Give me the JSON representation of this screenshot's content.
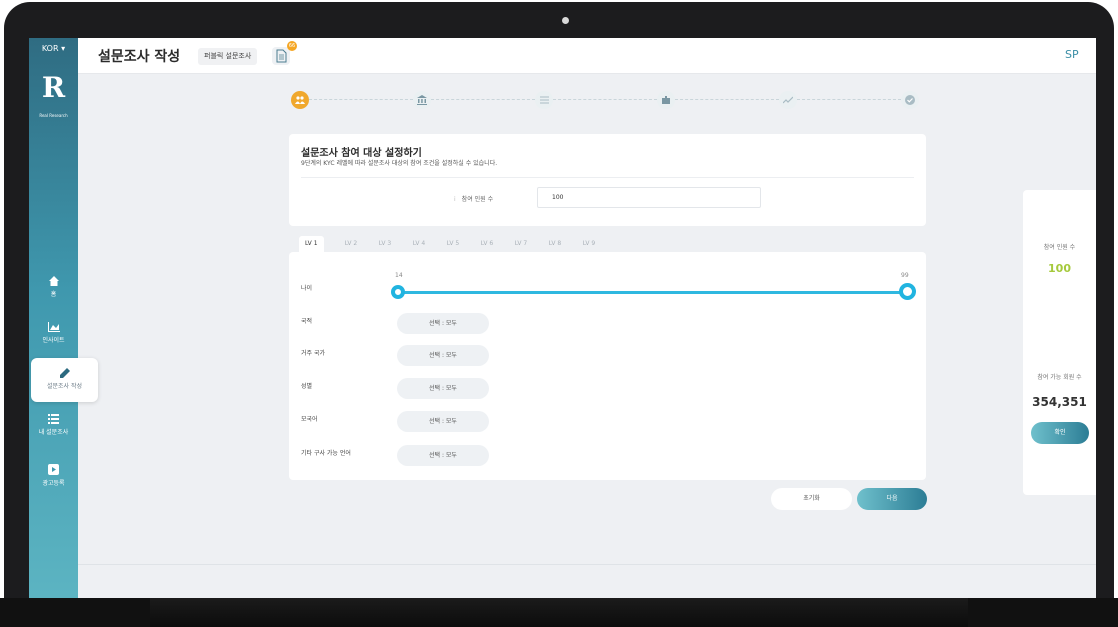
{
  "app": {
    "language": "KOR ▾",
    "logo_letter": "R",
    "logo_sub": "Real Research",
    "user_initials": "SP"
  },
  "header": {
    "title": "설문조사 작성",
    "tag": "퍼블릭 설문조사",
    "badge": "66"
  },
  "sidebar": {
    "items": [
      {
        "label": "홈",
        "icon": "home-icon"
      },
      {
        "label": "인사이트",
        "icon": "chart-icon"
      },
      {
        "label": "설문조사 작성",
        "icon": "pencil-icon"
      },
      {
        "label": "내 설문조사",
        "icon": "list-icon"
      },
      {
        "label": "광고등록",
        "icon": "play-icon"
      }
    ]
  },
  "stepper": {
    "steps": [
      "people-icon",
      "bank-icon",
      "list-icon",
      "puzzle-icon",
      "trend-icon",
      "check-icon"
    ],
    "active_index": 0
  },
  "section": {
    "title": "설문조사 참여 대상 설정하기",
    "description": "9단계의 KYC 레벨에 따라 설문조사 대상의 참여 조건을 설정하실 수 있습니다.",
    "participants_label": "참여 인원 수",
    "participants_value": "100"
  },
  "levels": {
    "tabs": [
      "LV 1",
      "LV 2",
      "LV 3",
      "LV 4",
      "LV 5",
      "LV 6",
      "LV 7",
      "LV 8",
      "LV 9"
    ],
    "active_index": 0
  },
  "criteria": {
    "age_label": "나이",
    "age_min": "14",
    "age_max": "99",
    "rows": [
      {
        "label": "국적",
        "value": "선택 : 모두"
      },
      {
        "label": "거주 국가",
        "value": "선택 : 모두"
      },
      {
        "label": "성별",
        "value": "선택 : 모두"
      },
      {
        "label": "모국어",
        "value": "선택 : 모두"
      },
      {
        "label": "기타 구사 가능 언어",
        "value": "선택 : 모두"
      }
    ]
  },
  "actions": {
    "reset": "초기화",
    "next": "다음"
  },
  "summary": {
    "participants_label": "참여 인원 수",
    "participants_value": "100",
    "available_label": "참여 가능 회원 수",
    "available_value": "354,351",
    "confirm": "확인"
  },
  "colors": {
    "accent_teal": "#2c7d95",
    "step_active": "#f0a82d",
    "slider": "#21b4e0",
    "count_green": "#a5c93c"
  }
}
